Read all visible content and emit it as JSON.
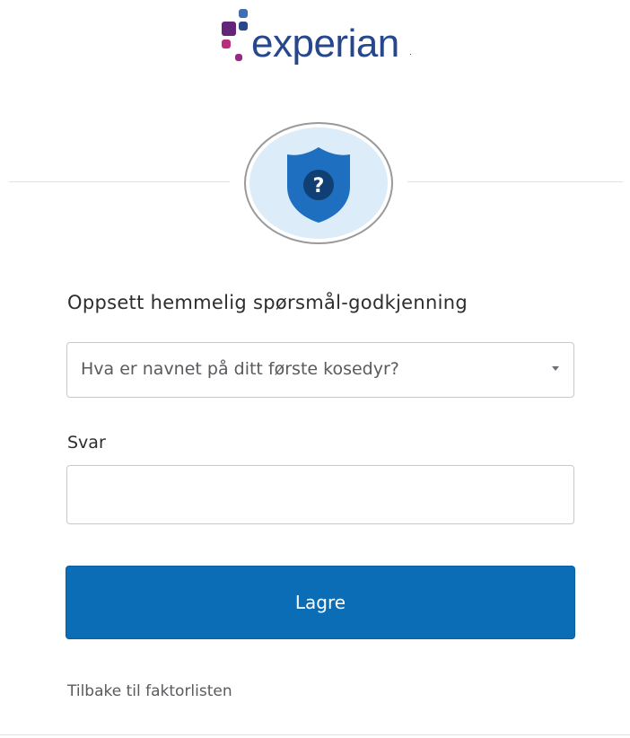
{
  "brand": {
    "name": "experian",
    "trademark": ".",
    "dot_colors": [
      "#26478d",
      "#982881",
      "#ba2f7d",
      "#406eb3",
      "#632678"
    ]
  },
  "badge": {
    "icon": "shield-question-icon",
    "glyph": "?",
    "colors": {
      "shield": "#1e6fbf",
      "circle": "#0f3f73",
      "ring_fill": "#dcecf8"
    }
  },
  "form": {
    "title": "Oppsett hemmelig spørsmål-godkjenning",
    "question_select": {
      "value": "Hva er navnet på ditt første kosedyr?"
    },
    "answer_label": "Svar",
    "answer_input": {
      "value": "",
      "placeholder": ""
    },
    "save_button": "Lagre",
    "back_link": "Tilbake til faktorlisten"
  },
  "colors": {
    "accent": "#0b6db5",
    "text": "#2d2d2d"
  }
}
